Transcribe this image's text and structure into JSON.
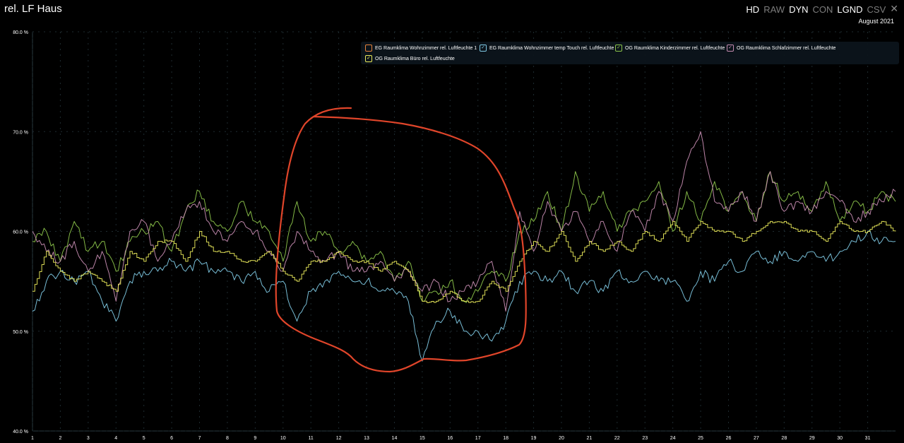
{
  "header": {
    "title": "rel. LF Haus",
    "period": "August 2021"
  },
  "toolbar": [
    {
      "label": "HD",
      "active": true
    },
    {
      "label": "RAW",
      "active": false
    },
    {
      "label": "DYN",
      "active": true
    },
    {
      "label": "CON",
      "active": false
    },
    {
      "label": "LGND",
      "active": true
    },
    {
      "label": "CSV",
      "active": false
    }
  ],
  "close_icon": "close-icon",
  "colors": {
    "orange": "#e8833a",
    "blue": "#7ec8e3",
    "green": "#8bc34a",
    "pink": "#c58bb0",
    "yellow": "#e8e85a",
    "annotation": "#e0452a"
  },
  "chart_data": {
    "type": "line",
    "title": "rel. LF Haus",
    "xlabel": "",
    "ylabel": "",
    "ylim": [
      40,
      80
    ],
    "yticks": [
      "40.0 %",
      "50.0 %",
      "60.0 %",
      "70.0 %",
      "80.0 %"
    ],
    "xticks": [
      "1",
      "2",
      "3",
      "4",
      "5",
      "6",
      "7",
      "8",
      "9",
      "10",
      "11",
      "12",
      "13",
      "14",
      "15",
      "16",
      "17",
      "18",
      "19",
      "20",
      "21",
      "22",
      "23",
      "24",
      "25",
      "26",
      "27",
      "28",
      "29",
      "30",
      "31"
    ],
    "xlim": [
      1,
      32
    ],
    "grid": true,
    "legend_position": "top",
    "series": [
      {
        "name": "EG Raumklima Wohnzimmer rel. Luftfeuchte 1",
        "color": "#e8833a",
        "checked": true,
        "x": [],
        "y": []
      },
      {
        "name": "EG Raumklima Wohnzimmer temp Touch rel. Luftfeuchte",
        "color": "#7ec8e3",
        "checked": true,
        "x": [
          1,
          1.5,
          2,
          2.5,
          3,
          3.5,
          4,
          4.5,
          5,
          5.5,
          6,
          6.5,
          7,
          7.5,
          8,
          8.5,
          9,
          9.5,
          10,
          10.5,
          11,
          11.5,
          12,
          12.5,
          13,
          13.5,
          14,
          14.5,
          15,
          15.5,
          16,
          16.5,
          17,
          17.5,
          18,
          18.5,
          19,
          19.5,
          20,
          20.5,
          21,
          21.5,
          22,
          22.5,
          23,
          23.5,
          24,
          24.5,
          25,
          25.5,
          26,
          26.5,
          27,
          27.5,
          28,
          28.5,
          29,
          29.5,
          30,
          30.5,
          31,
          31.5,
          32
        ],
        "y": [
          52,
          55,
          56,
          55,
          56,
          53,
          51,
          55,
          56,
          56,
          57,
          56,
          57,
          56,
          56,
          55,
          56,
          54,
          55,
          51,
          54,
          55,
          56,
          55,
          55,
          54,
          54,
          53,
          47,
          51,
          52,
          50,
          50,
          49,
          51,
          55,
          56,
          55,
          56,
          54,
          55,
          54,
          56,
          55,
          56,
          55,
          55,
          53,
          56,
          55,
          57,
          56,
          58,
          57,
          58,
          57,
          58,
          57,
          58,
          59,
          60,
          59,
          59
        ]
      },
      {
        "name": "OG Raumklima Kinderzimmer rel. Luftfeuchte",
        "color": "#8bc34a",
        "checked": true,
        "x": [
          1,
          1.5,
          2,
          2.5,
          3,
          3.5,
          4,
          4.5,
          5,
          5.5,
          6,
          6.5,
          7,
          7.5,
          8,
          8.5,
          9,
          9.5,
          10,
          10.5,
          11,
          11.5,
          12,
          12.5,
          13,
          13.5,
          14,
          14.5,
          15,
          15.5,
          16,
          16.5,
          17,
          17.5,
          18,
          18.5,
          19,
          19.5,
          20,
          20.5,
          21,
          21.5,
          22,
          22.5,
          23,
          23.5,
          24,
          24.5,
          25,
          25.5,
          26,
          26.5,
          27,
          27.5,
          28,
          28.5,
          29,
          29.5,
          30,
          30.5,
          31,
          31.5,
          32
        ],
        "y": [
          59,
          60,
          57,
          61,
          58,
          59,
          56,
          59,
          60,
          61,
          58,
          62,
          64,
          61,
          60,
          63,
          61,
          60,
          57,
          63,
          59,
          60,
          58,
          59,
          57,
          58,
          55,
          57,
          53,
          54,
          55,
          53,
          54,
          56,
          55,
          60,
          61,
          64,
          60,
          66,
          62,
          64,
          60,
          62,
          63,
          65,
          60,
          64,
          61,
          65,
          62,
          64,
          61,
          66,
          63,
          64,
          62,
          65,
          61,
          63,
          62,
          64,
          63
        ]
      },
      {
        "name": "OG Raumklima Schlafzimmer rel. Luftfeuchte",
        "color": "#c58bb0",
        "checked": true,
        "x": [
          1,
          1.5,
          2,
          2.5,
          3,
          3.5,
          4,
          4.5,
          5,
          5.5,
          6,
          6.5,
          7,
          7.5,
          8,
          8.5,
          9,
          9.5,
          10,
          10.5,
          11,
          11.5,
          12,
          12.5,
          13,
          13.5,
          14,
          14.5,
          15,
          15.5,
          16,
          16.5,
          17,
          17.5,
          18,
          18.5,
          19,
          19.5,
          20,
          20.5,
          21,
          21.5,
          22,
          22.5,
          23,
          23.5,
          24,
          24.5,
          25,
          25.5,
          26,
          26.5,
          27,
          27.5,
          28,
          28.5,
          29,
          29.5,
          30,
          30.5,
          31,
          31.5,
          32
        ],
        "y": [
          60,
          58,
          57,
          59,
          56,
          58,
          53,
          60,
          61,
          57,
          59,
          62,
          63,
          60,
          59,
          61,
          60,
          58,
          56,
          60,
          58,
          57,
          58,
          56,
          56,
          57,
          55,
          56,
          54,
          55,
          53,
          54,
          55,
          57,
          52,
          62,
          58,
          63,
          60,
          62,
          59,
          61,
          58,
          62,
          60,
          64,
          61,
          67,
          70,
          63,
          62,
          64,
          61,
          66,
          62,
          63,
          62,
          64,
          63,
          61,
          62,
          63,
          64
        ]
      },
      {
        "name": "OG Raumklima Büro rel. Luftfeuchte",
        "color": "#e8e85a",
        "checked": true,
        "x": [
          1,
          1.5,
          2,
          2.5,
          3,
          3.5,
          4,
          4.5,
          5,
          5.5,
          6,
          6.5,
          7,
          7.5,
          8,
          8.5,
          9,
          9.5,
          10,
          10.5,
          11,
          11.5,
          12,
          12.5,
          13,
          13.5,
          14,
          14.5,
          15,
          15.5,
          16,
          16.5,
          17,
          17.5,
          18,
          18.5,
          19,
          19.5,
          20,
          20.5,
          21,
          21.5,
          22,
          22.5,
          23,
          23.5,
          24,
          24.5,
          25,
          25.5,
          26,
          26.5,
          27,
          27.5,
          28,
          28.5,
          29,
          29.5,
          30,
          30.5,
          31,
          31.5,
          32
        ],
        "y": [
          54,
          58,
          56,
          55,
          56,
          55,
          54,
          58,
          57,
          59,
          59,
          57,
          60,
          58,
          58,
          57,
          57,
          58,
          56,
          55,
          57,
          57,
          58,
          57,
          57,
          56,
          57,
          56,
          53,
          53,
          54,
          53,
          53,
          55,
          54,
          57,
          59,
          58,
          60,
          57,
          59,
          58,
          59,
          58,
          60,
          59,
          61,
          59,
          61,
          60,
          60,
          59,
          60,
          61,
          61,
          60,
          60,
          59,
          61,
          60,
          60,
          61,
          60
        ]
      }
    ]
  }
}
